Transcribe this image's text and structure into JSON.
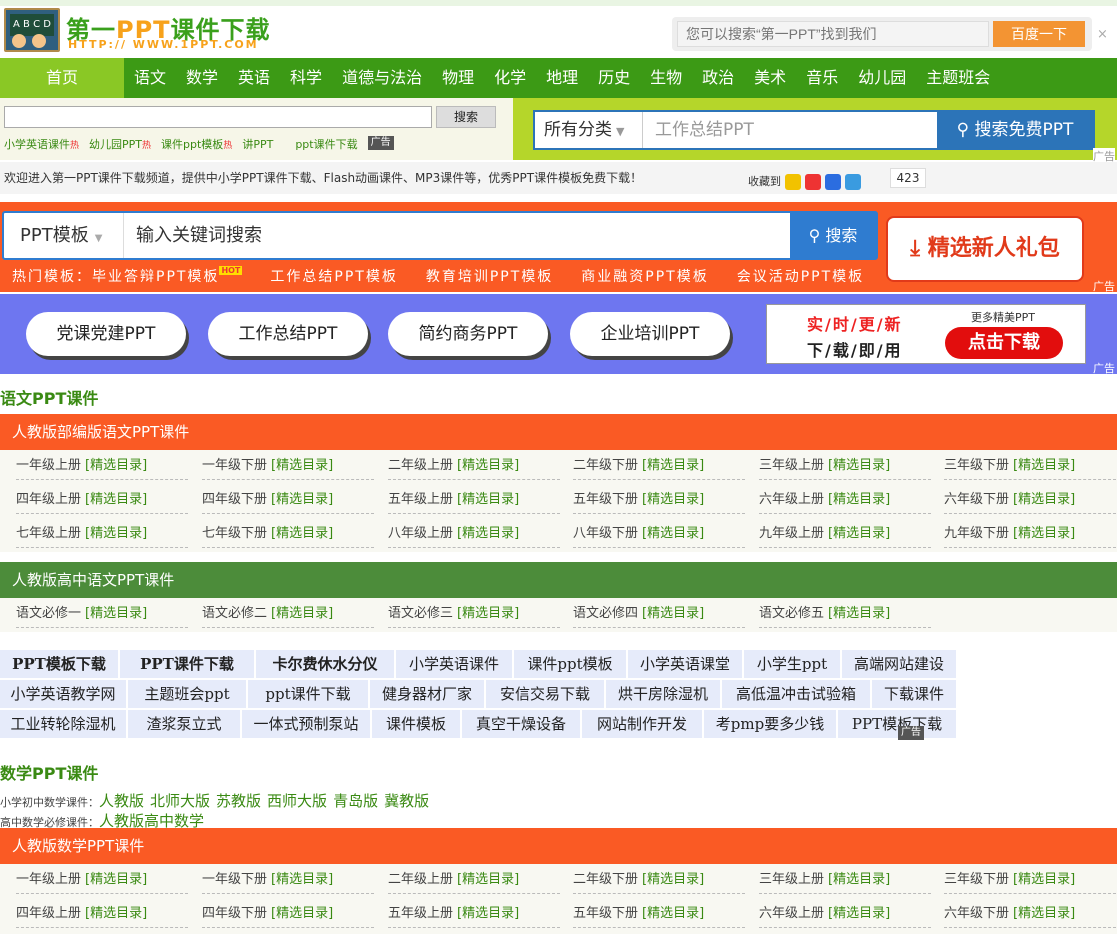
{
  "header": {
    "logo_board": "A B C D",
    "logo_title_pre": "第一",
    "logo_title_ppt": "PPT",
    "logo_title_post": "课件下载",
    "logo_url": "HTTP:// WWW.1PPT.COM",
    "search_placeholder": "您可以搜索“第一PPT”找到我们",
    "search_button": "百度一下",
    "close": "×"
  },
  "nav": {
    "home": "首页",
    "items": [
      "语文",
      "数学",
      "英语",
      "科学",
      "道德与法治",
      "物理",
      "化学",
      "地理",
      "历史",
      "生物",
      "政治",
      "美术",
      "音乐",
      "幼儿园",
      "主题班会"
    ]
  },
  "search_band": {
    "button": "搜索",
    "hot_links": [
      "小学英语课件",
      "幼儿园PPT",
      "课件ppt模板",
      "讲PPT",
      "ppt课件下载"
    ],
    "hot_mark": "热",
    "ad_label": "广告",
    "category": "所有分类",
    "placeholder": "工作总结PPT",
    "go": "搜索免费PPT",
    "corner_ad": "广告"
  },
  "welcome": {
    "text": "欢迎进入第一PPT课件下载频道，提供中小学PPT课件下载、Flash动画课件、MP3课件等，优秀PPT课件模板免费下载！",
    "fav_label": "收藏到",
    "count": "423"
  },
  "orange_band": {
    "category": "PPT模板",
    "placeholder": "输入关键词搜索",
    "go": "搜索",
    "gift": "精选新人礼包",
    "hot_prefix": "热门模板：",
    "hot_badge": "HOT",
    "templates": [
      "毕业答辩PPT模板",
      "工作总结PPT模板",
      "教育培训PPT模板",
      "商业融资PPT模板",
      "会议活动PPT模板"
    ],
    "corner_ad": "广告"
  },
  "purple_band": {
    "pills": [
      "党课党建PPT",
      "工作总结PPT",
      "简约商务PPT",
      "企业培训PPT"
    ],
    "line1": "实/时/更/新",
    "line2": "下/载/即/用",
    "more": "更多精美PPT",
    "download": "点击下载",
    "corner_ad": "广告"
  },
  "chinese": {
    "title": "语文PPT课件",
    "bar1": "人教版部编版语文PPT课件",
    "grades": [
      "一年级上册",
      "一年级下册",
      "二年级上册",
      "二年级下册",
      "三年级上册",
      "三年级下册",
      "四年级上册",
      "四年级下册",
      "五年级上册",
      "五年级下册",
      "六年级上册",
      "六年级下册",
      "七年级上册",
      "七年级下册",
      "八年级上册",
      "八年级下册",
      "九年级上册",
      "九年级下册"
    ],
    "catalog": "[精选目录]",
    "bar2": "人教版高中语文PPT课件",
    "high": [
      "语文必修一",
      "语文必修二",
      "语文必修三",
      "语文必修四",
      "语文必修五"
    ]
  },
  "tags": {
    "row1": [
      "PPT模板下载",
      "PPT课件下载",
      "卡尔费休水分仪",
      "小学英语课件",
      "课件ppt模板",
      "小学英语课堂",
      "小学生ppt",
      "高端网站建设"
    ],
    "row2": [
      "小学英语教学网",
      "主题班会ppt",
      "ppt课件下载",
      "健身器材厂家",
      "安信交易下载",
      "烘干房除湿机",
      "高低温冲击试验箱",
      "下载课件"
    ],
    "row3": [
      "工业转轮除湿机",
      "渣浆泵立式",
      "一体式预制泵站",
      "课件模板",
      "真空干燥设备",
      "网站制作开发",
      "考pmp要多少钱",
      "PPT模板下载"
    ],
    "ad_label": "广告"
  },
  "math": {
    "title": "数学PPT课件",
    "line1_prefix": "小学初中数学课件：",
    "line1_links": [
      "人教版",
      "北师大版",
      "苏教版",
      "西师大版",
      "青岛版",
      "冀教版"
    ],
    "line2_prefix": "高中数学必修课件：",
    "line2_links": [
      "人教版高中数学"
    ],
    "bar": "人教版数学PPT课件",
    "grades": [
      "一年级上册",
      "一年级下册",
      "二年级上册",
      "二年级下册",
      "三年级上册",
      "三年级下册",
      "四年级上册",
      "四年级下册",
      "五年级上册",
      "五年级下册",
      "六年级上册",
      "六年级下册"
    ],
    "catalog": "[精选目录]"
  }
}
